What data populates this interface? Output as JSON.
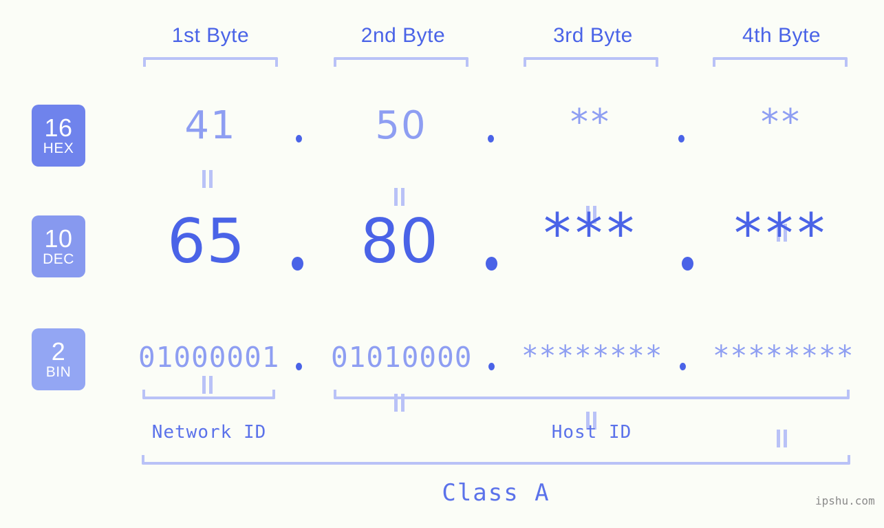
{
  "page": {
    "background": "#fbfdf7",
    "accent_dark": "#4a63e7",
    "accent_mid": "#8e9ef2",
    "accent_light": "#b9c2f7"
  },
  "byte_headers": [
    {
      "label": "1st Byte"
    },
    {
      "label": "2nd Byte"
    },
    {
      "label": "3rd Byte"
    },
    {
      "label": "4th Byte"
    }
  ],
  "bases": [
    {
      "number": "16",
      "name": "HEX",
      "color": "#6f83ec"
    },
    {
      "number": "10",
      "name": "DEC",
      "color": "#8799ef"
    },
    {
      "number": "2",
      "name": "BIN",
      "color": "#93a6f3"
    }
  ],
  "rows": {
    "hex": {
      "base_number": "16",
      "base_name": "HEX",
      "values": [
        "41",
        "50",
        "**",
        "**"
      ],
      "separators": [
        ".",
        ".",
        "."
      ]
    },
    "dec": {
      "base_number": "10",
      "base_name": "DEC",
      "values": [
        "65",
        "80",
        "***",
        "***"
      ],
      "separators": [
        ".",
        ".",
        "."
      ]
    },
    "bin": {
      "base_number": "2",
      "base_name": "BIN",
      "values": [
        "01000001",
        "01010000",
        "********",
        "********"
      ],
      "separators": [
        ".",
        ".",
        "."
      ]
    }
  },
  "equality_marks": {
    "symbol": "||",
    "count_per_row": 4,
    "rows": 2
  },
  "id_sections": [
    {
      "label": "Network ID"
    },
    {
      "label": "Host ID"
    }
  ],
  "class_section": {
    "label": "Class A"
  },
  "watermark": {
    "text": "ipshu.com"
  }
}
